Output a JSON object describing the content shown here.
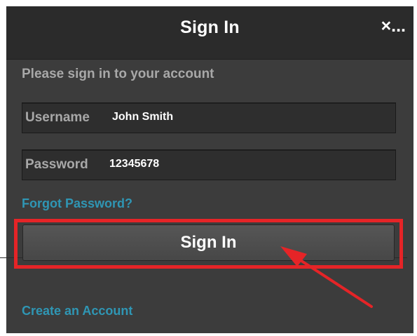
{
  "dialog": {
    "title": "Sign In",
    "close_label": "×..."
  },
  "form": {
    "prompt": "Please sign in to your account",
    "username": {
      "label": "Username",
      "value": "John Smith"
    },
    "password": {
      "label": "Password",
      "value": "12345678"
    },
    "forgot_password_label": "Forgot Password?",
    "sign_in_label": "Sign In",
    "create_account_label": "Create an Account"
  },
  "annotation": {
    "highlight_color": "#e52427",
    "target": "sign-in-button"
  },
  "colors": {
    "title_bar": "#2b2b2b",
    "background": "#3c3c3c",
    "link": "#2f96b4",
    "muted_text": "#a8a8a8"
  }
}
